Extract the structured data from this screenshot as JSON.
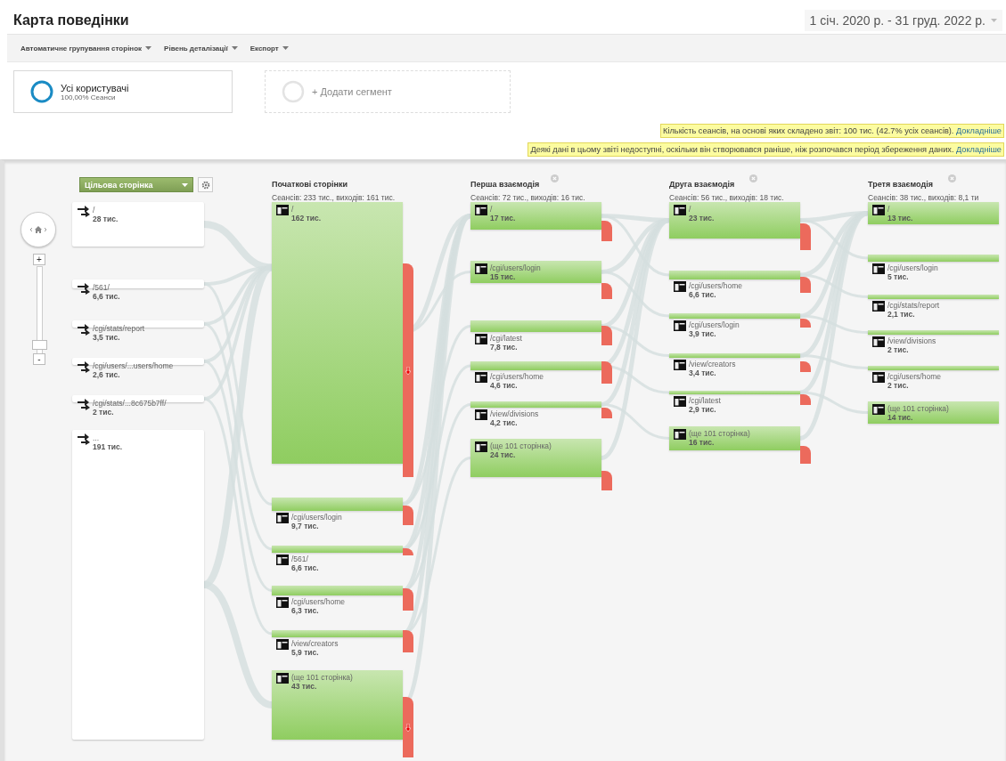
{
  "page": {
    "title": "Карта поведінки",
    "date_range": "1 січ. 2020 р. - 31 груд. 2022 р."
  },
  "toolbar": [
    {
      "label": "Автоматичне групування сторінок"
    },
    {
      "label": "Рівень деталізації"
    },
    {
      "label": "Експорт"
    }
  ],
  "segments": [
    {
      "kind": "segment",
      "title": "Усі користувачі",
      "subtitle": "100,00% Сеанси"
    },
    {
      "kind": "add",
      "title": "+ Додати сегмент"
    }
  ],
  "notices": [
    {
      "text": "Кількість сеансів, на основі яких складено звіт: 100 тис. (42.7% усіх сеансів).",
      "link": "Докладніше"
    },
    {
      "text": "Деякі дані в цьому звіті недоступні, оскільки він створювався раніше, ніж розпочався період збереження даних.",
      "link": "Докладніше"
    }
  ],
  "zoom": {
    "zoom_in": "+",
    "zoom_out": "-"
  },
  "flow": {
    "dimension": "Цільова сторінка",
    "sources": [
      {
        "path": "/",
        "count": "28 тис."
      },
      {
        "path": "/561/",
        "count": "6,6 тис."
      },
      {
        "path": "/cgi/stats/report",
        "count": "3,5 тис."
      },
      {
        "path": "/cgi/users/...users/home",
        "count": "2,6 тис."
      },
      {
        "path": "/cgi/stats/...8c675b7ff/",
        "count": "2 тис."
      },
      {
        "path": "...",
        "count": "191 тис."
      }
    ],
    "columns": [
      {
        "title": "Початкові сторінки",
        "summary": "Сеансів: 233 тис., виходів: 161 тис.",
        "removable": false,
        "nodes": [
          {
            "path": "/",
            "count": "162 тис."
          },
          {
            "path": "/cgi/users/login",
            "count": "9,7 тис."
          },
          {
            "path": "/561/",
            "count": "6,6 тис."
          },
          {
            "path": "/cgi/users/home",
            "count": "6,3 тис."
          },
          {
            "path": "/view/creators",
            "count": "5,9 тис."
          },
          {
            "path": "(ще 101 сторінка)",
            "count": "43 тис."
          }
        ]
      },
      {
        "title": "Перша взаємодія",
        "summary": "Сеансів: 72 тис., виходів: 16 тис.",
        "removable": true,
        "nodes": [
          {
            "path": "/",
            "count": "17 тис."
          },
          {
            "path": "/cgi/users/login",
            "count": "15 тис."
          },
          {
            "path": "/cgi/latest",
            "count": "7,8 тис."
          },
          {
            "path": "/cgi/users/home",
            "count": "4,6 тис."
          },
          {
            "path": "/view/divisions",
            "count": "4,2 тис."
          },
          {
            "path": "(ще 101 сторінка)",
            "count": "24 тис."
          }
        ]
      },
      {
        "title": "Друга взаємодія",
        "summary": "Сеансів: 56 тис., виходів: 18 тис.",
        "removable": true,
        "nodes": [
          {
            "path": "/",
            "count": "23 тис."
          },
          {
            "path": "/cgi/users/home",
            "count": "6,6 тис."
          },
          {
            "path": "/cgi/users/login",
            "count": "3,9 тис."
          },
          {
            "path": "/view/creators",
            "count": "3,4 тис."
          },
          {
            "path": "/cgi/latest",
            "count": "2,9 тис."
          },
          {
            "path": "(ще 101 сторінка)",
            "count": "16 тис."
          }
        ]
      },
      {
        "title": "Третя взаємодія",
        "summary": "Сеансів: 38 тис., виходів: 8,1 ти",
        "removable": true,
        "nodes": [
          {
            "path": "/",
            "count": "13 тис."
          },
          {
            "path": "/cgi/users/login",
            "count": "5 тис."
          },
          {
            "path": "/cgi/stats/report",
            "count": "2,1 тис."
          },
          {
            "path": "/view/divisions",
            "count": "2 тис."
          },
          {
            "path": "/cgi/users/home",
            "count": "2 тис."
          },
          {
            "path": "(ще 101 сторінка)",
            "count": "14 тис."
          }
        ]
      }
    ]
  }
}
